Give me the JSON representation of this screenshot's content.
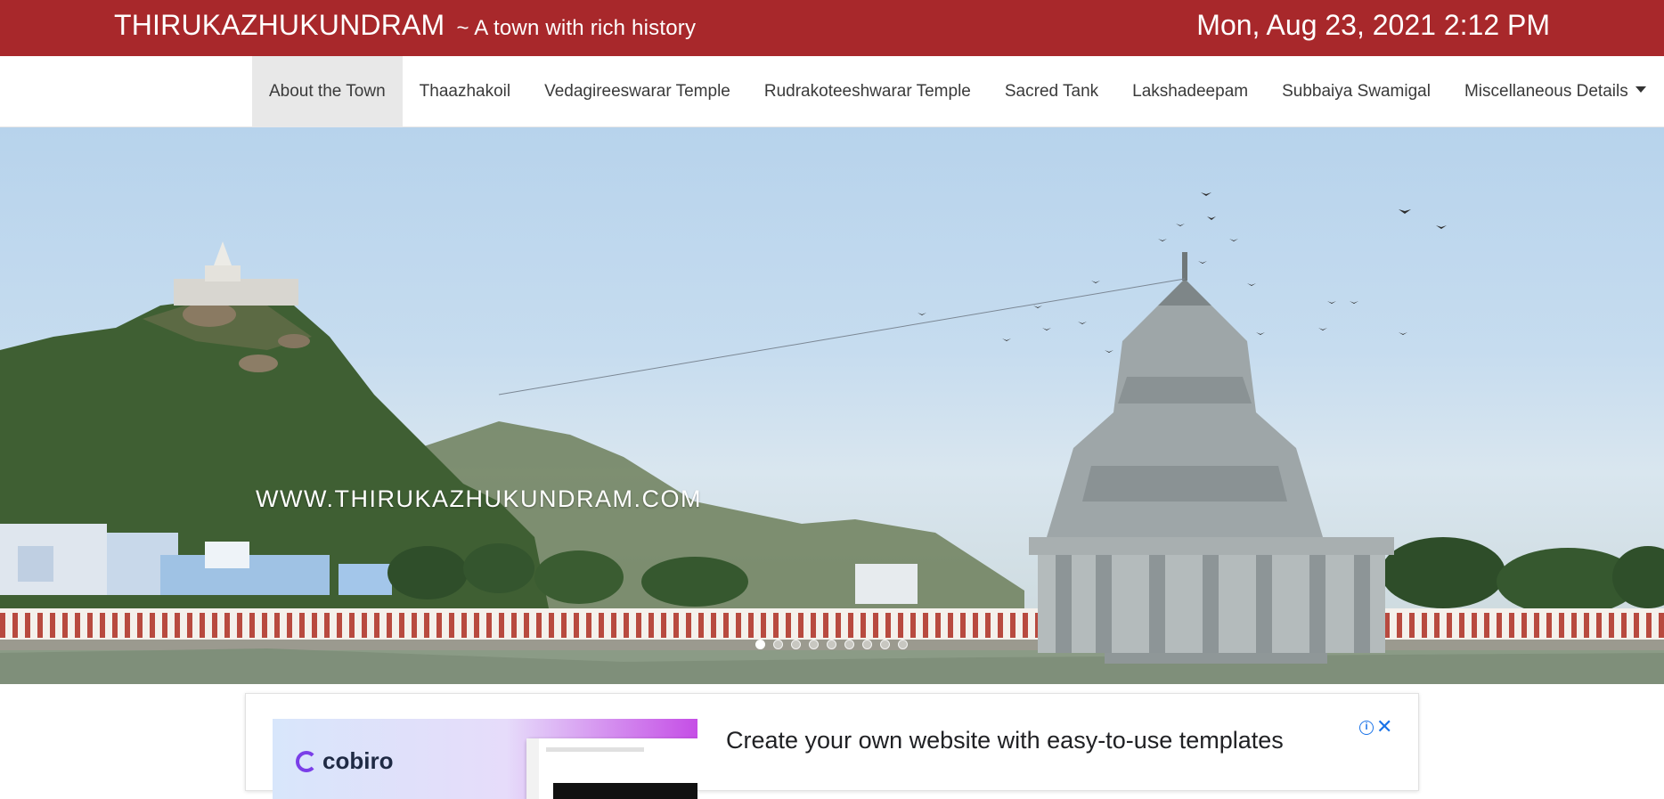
{
  "header": {
    "title": "THIRUKAZHUKUNDRAM",
    "tagline": "~ A town with rich history",
    "datetime": "Mon, Aug 23, 2021 2:12 PM",
    "bg_color": "#a8282b"
  },
  "nav": {
    "items": [
      {
        "label": "About the Town",
        "active": true
      },
      {
        "label": "Thaazhakoil"
      },
      {
        "label": "Vedagireeswarar Temple"
      },
      {
        "label": "Rudrakoteeshwarar Temple"
      },
      {
        "label": "Sacred Tank"
      },
      {
        "label": "Lakshadeepam"
      },
      {
        "label": "Subbaiya Swamigal"
      },
      {
        "label": "Miscellaneous Details"
      }
    ],
    "more_icon": "chevron-down-icon"
  },
  "hero": {
    "watermark": "WWW.THIRUKAZHUKUNDRAM.COM",
    "slide_count": 9,
    "active_slide": 1
  },
  "ad": {
    "brand": "cobiro",
    "headline": "Create your own website with easy-to-use templates",
    "info_icon": "info-icon",
    "close_icon": "close-icon"
  }
}
